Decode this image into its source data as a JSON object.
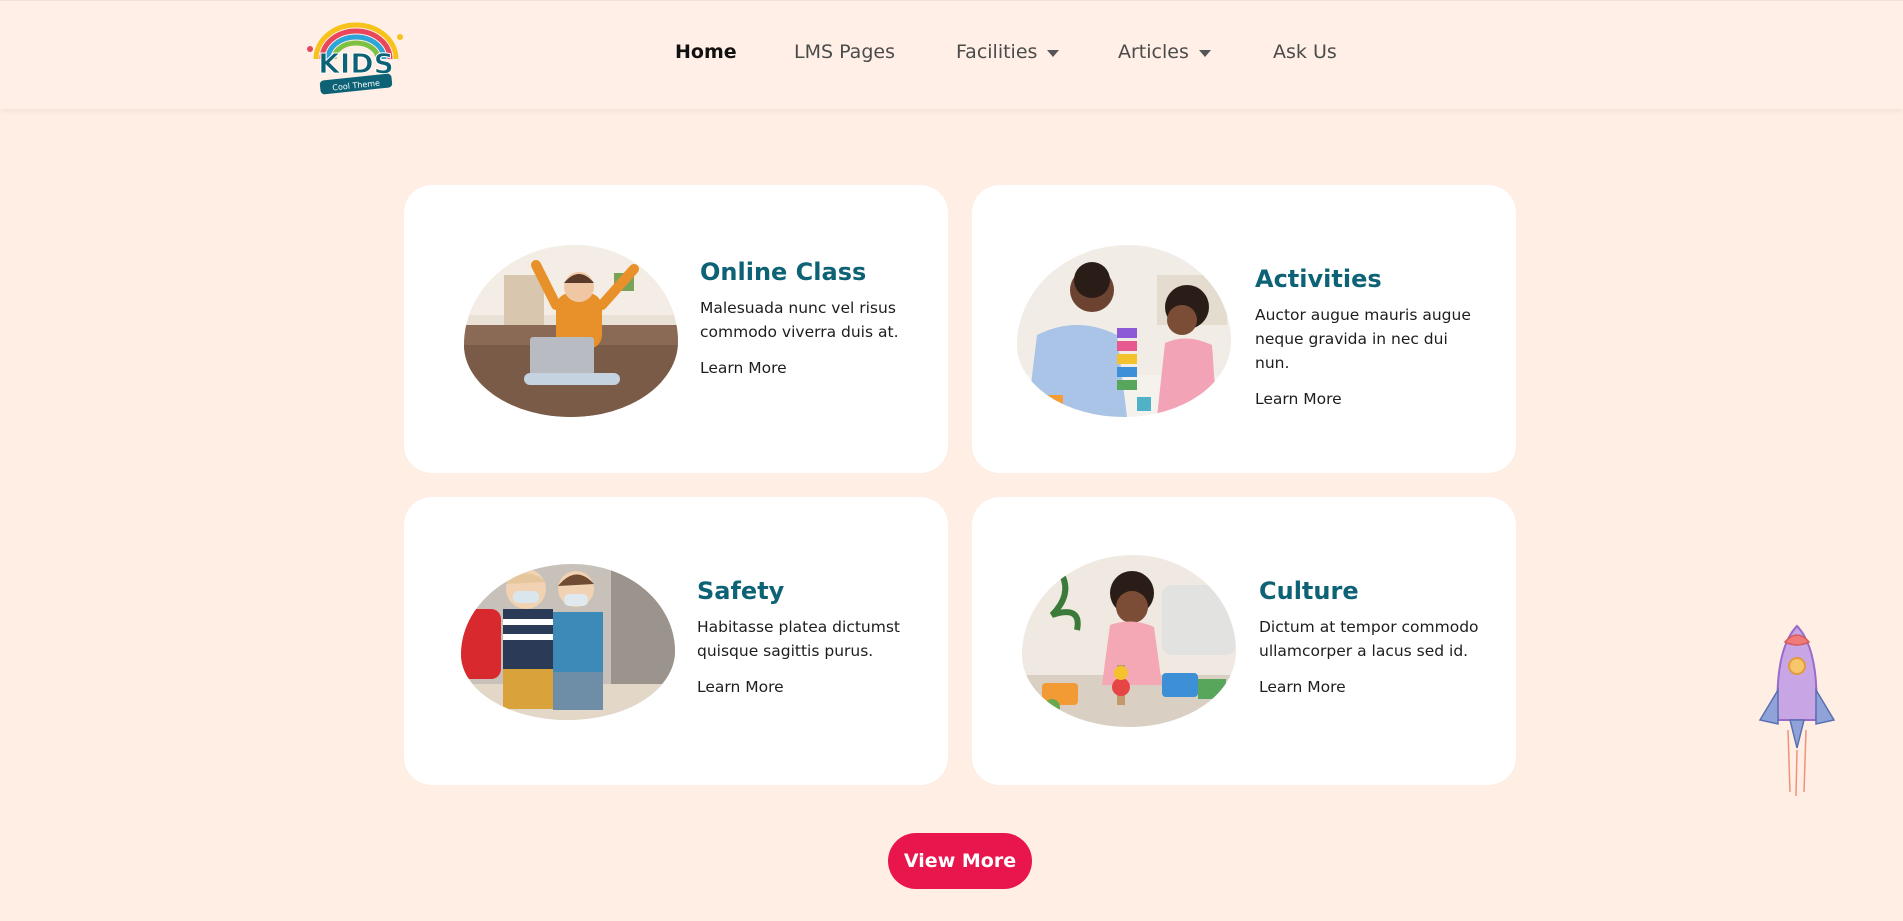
{
  "header": {
    "logo_text": "KIDS",
    "logo_subtext": "Cool Theme",
    "nav": [
      {
        "label": "Home",
        "active": true,
        "dropdown": false
      },
      {
        "label": "LMS Pages",
        "active": false,
        "dropdown": false
      },
      {
        "label": "Facilities",
        "active": false,
        "dropdown": true
      },
      {
        "label": "Articles",
        "active": false,
        "dropdown": true
      },
      {
        "label": "Ask Us",
        "active": false,
        "dropdown": false
      }
    ]
  },
  "cards": [
    {
      "title": "Online Class",
      "description": "Malesuada nunc vel risus commodo viverra duis at.",
      "link": "Learn More",
      "image": "child-with-laptop-photo"
    },
    {
      "title": "Activities",
      "description": "Auctor augue mauris augue neque gravida in nec dui nun.",
      "link": "Learn More",
      "image": "teacher-child-blocks-photo"
    },
    {
      "title": "Safety",
      "description": "Habitasse platea dictumst quisque sagittis purus.",
      "link": "Learn More",
      "image": "children-with-masks-photo"
    },
    {
      "title": "Culture",
      "description": "Dictum at tempor commodo ullamcorper a lacus sed id.",
      "link": "Learn More",
      "image": "child-playing-toys-photo"
    }
  ],
  "view_more_label": "View More",
  "colors": {
    "background": "#ffeee4",
    "title": "#0d6276",
    "button": "#e8164c"
  }
}
